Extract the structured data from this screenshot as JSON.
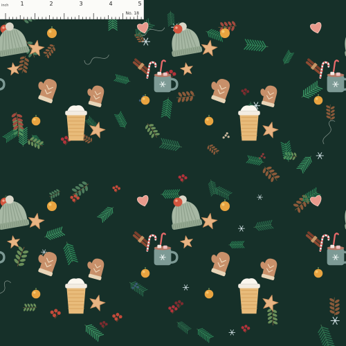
{
  "ruler": {
    "unit_label": "inch",
    "numbers": [
      "1",
      "2",
      "3",
      "4",
      "5"
    ],
    "swatch_number": "No. 18"
  },
  "pattern": {
    "background_color": "#163029",
    "motifs": [
      "knit-beanie-hat",
      "mitten",
      "mug-with-marshmallows",
      "latte-cup",
      "gingerbread-star",
      "heart-cookie",
      "orange-ornament",
      "red-berries",
      "cinnamon-sticks",
      "candy-cane",
      "snowflake",
      "pine-branch",
      "holly-leaf"
    ],
    "colors": {
      "hat": "#a7b8a4",
      "mitten": "#c8906a",
      "mug": "#7d9a95",
      "latte": "#e8bb7a",
      "star": "#e8b483",
      "heart": "#e89a8c",
      "orange": "#e9a440",
      "berry": "#b2333b",
      "pine": "#2c8a5a",
      "snow": "#d7e6ea"
    }
  }
}
